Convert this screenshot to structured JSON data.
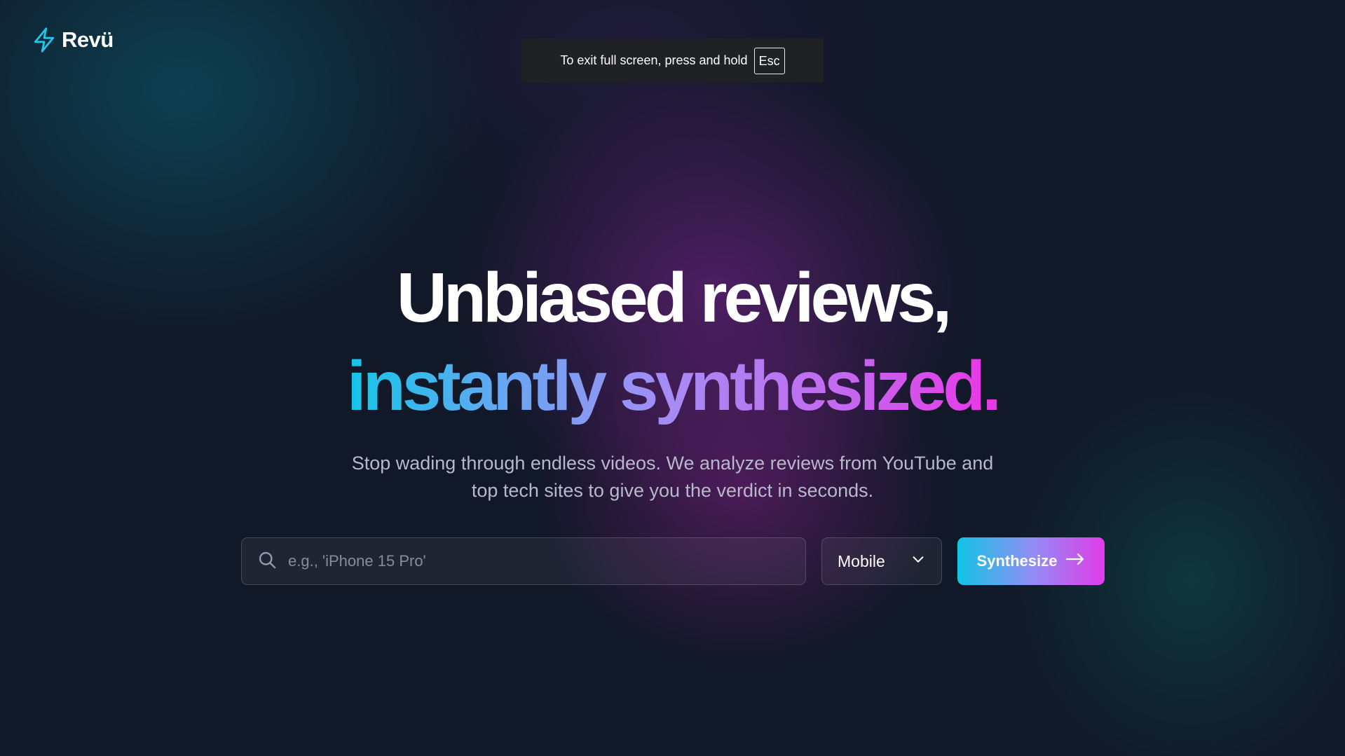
{
  "brand": {
    "name": "Revü",
    "icon": "lightning-bolt-icon",
    "icon_color": "#22c3e6"
  },
  "fullscreen_notice": {
    "text": "To exit full screen, press and hold",
    "key": "Esc"
  },
  "hero": {
    "line1": "Unbiased reviews,",
    "line2": "instantly synthesized.",
    "subtitle_line1": "Stop wading through endless videos. We analyze reviews from YouTube and",
    "subtitle_line2": "top tech sites to give you the verdict in seconds."
  },
  "search": {
    "placeholder": "e.g., 'iPhone 15 Pro'",
    "value": "",
    "icon": "search-icon"
  },
  "category": {
    "selected": "Mobile",
    "icon": "chevron-down-icon"
  },
  "submit": {
    "label": "Synthesize",
    "icon": "arrow-right-icon"
  },
  "colors": {
    "background": "#111827",
    "gradient_start": "#13c6e8",
    "gradient_mid": "#a78bf4",
    "gradient_end": "#e936e5"
  }
}
